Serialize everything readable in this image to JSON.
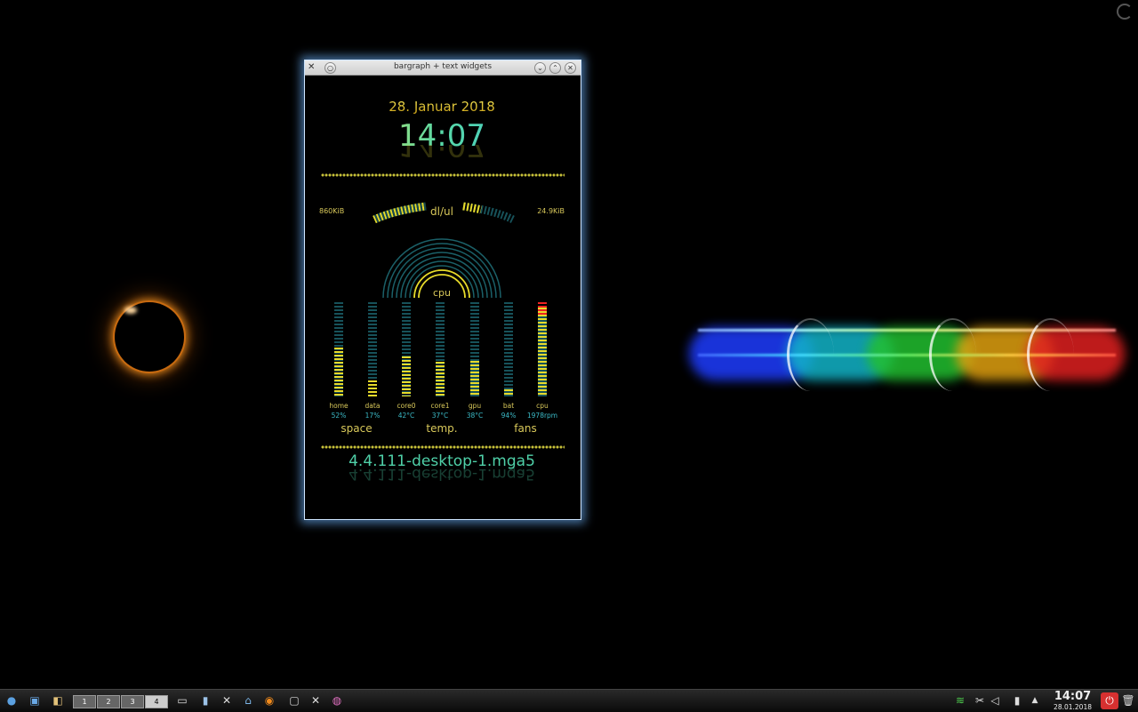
{
  "window": {
    "title": "bargraph + text widgets",
    "menu_glyph": "✕",
    "sticky_glyph": "○",
    "min_glyph": "⌄",
    "max_glyph": "⌃",
    "close_glyph": "✕"
  },
  "widget": {
    "date": "28. Januar 2018",
    "time": "14:07",
    "download": "860KiB",
    "upload": "24.9KiB",
    "net_label": "dl/ul",
    "cpu_label": "cpu",
    "bars": [
      {
        "label": "home",
        "value": "52%",
        "level": 0.52
      },
      {
        "label": "data",
        "value": "17%",
        "level": 0.17
      },
      {
        "label": "core0",
        "value": "42°C",
        "level": 0.42
      },
      {
        "label": "core1",
        "value": "37°C",
        "level": 0.37
      },
      {
        "label": "gpu",
        "value": "38°C",
        "level": 0.38
      },
      {
        "label": "bat",
        "value": "94%",
        "level": 0.08
      },
      {
        "label": "cpu",
        "value": "1978rpm",
        "level": 0.94
      }
    ],
    "groups": {
      "space": "space",
      "temp": "temp.",
      "fans": "fans"
    },
    "kernel": "4.4.111-desktop-1.mga5"
  },
  "taskbar": {
    "desktops": [
      "1",
      "2",
      "3",
      "4"
    ],
    "clock_time": "14:07",
    "clock_date": "28.01.2018"
  },
  "colors": {
    "accent_yellow": "#e6da2a",
    "accent_teal": "#17525a",
    "accent_cyan": "#3bbac7",
    "window_glow": "#6eb4ff"
  }
}
